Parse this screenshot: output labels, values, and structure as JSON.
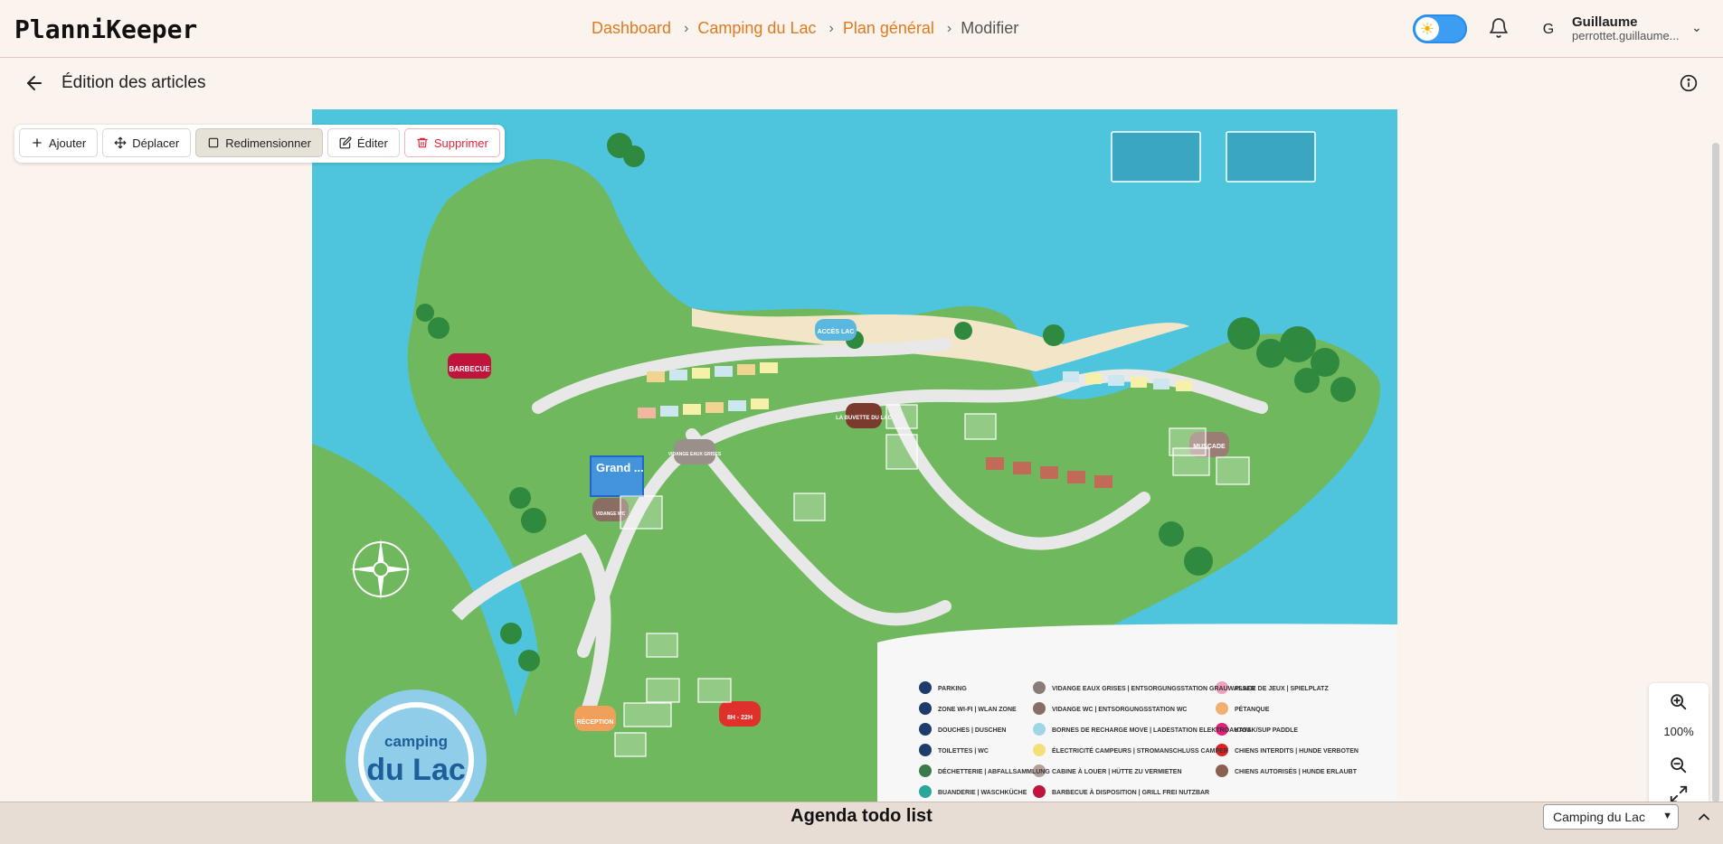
{
  "app": {
    "logo": "PlanniKeeper"
  },
  "breadcrumb": [
    {
      "label": "Dashboard"
    },
    {
      "label": "Camping du Lac"
    },
    {
      "label": "Plan général"
    },
    {
      "label": "Modifier"
    }
  ],
  "user": {
    "initial": "G",
    "name": "Guillaume",
    "email": "perrottet.guillaume..."
  },
  "subheader": {
    "title": "Édition des articles"
  },
  "toolbar": {
    "add": "Ajouter",
    "move": "Déplacer",
    "resize": "Redimensionner",
    "edit": "Éditer",
    "delete": "Supprimer"
  },
  "map": {
    "selected_item_label": "Grand ...",
    "labels": {
      "barbecue": "BARBECUE",
      "acces_lac": "ACCÈS LAC",
      "buvette": "LA BUVETTE DU LAC",
      "vidange_grises": "VIDANGE EAUX GRISES",
      "vidange_wc": "VIDANGE WC",
      "muscade": "MUSCADE",
      "reception": "RÉCEPTION",
      "horaires": "8H - 22H",
      "logo_top": "camping",
      "logo_main": "du Lac"
    },
    "legend": [
      "PARKING",
      "ZONE WI-FI | WLAN ZONE",
      "DOUCHES | DUSCHEN",
      "TOILETTES | WC",
      "DÉCHETTERIE | ABFALLSAMMLUNG",
      "BUANDERIE | WASCHKÜCHE",
      "VIDANGE EAUX GRISES | ENTSORGUNGSSTATION GRAUWASSER",
      "VIDANGE WC | ENTSORGUNGSSTATION WC",
      "BORNES DE RECHARGE MOVE | LADESTATION ELEKTROAUTOS",
      "ÉLECTRICITÉ CAMPEURS | STROMANSCHLUSS CAMPER",
      "CABINE À LOUER | HÜTTE ZU VERMIETEN",
      "BARBECUE À DISPOSITION | GRILL FREI NUTZBAR",
      "PLACE DE JEUX | SPIELPLATZ",
      "PÉTANQUE",
      "KAYAK/SUP PADDLE",
      "CHIENS INTERDITS | HUNDE VERBOTEN",
      "CHIENS AUTORISÉS | HUNDE ERLAUBT"
    ]
  },
  "zoom": {
    "level": "100%"
  },
  "agenda": {
    "title": "Agenda todo list",
    "selected_camping": "Camping du Lac"
  },
  "colors": {
    "accent": "#e07a1f",
    "toggle": "#3d9df2",
    "danger": "#e3243b",
    "water": "#4ec5dd",
    "land": "#6fb85d"
  }
}
